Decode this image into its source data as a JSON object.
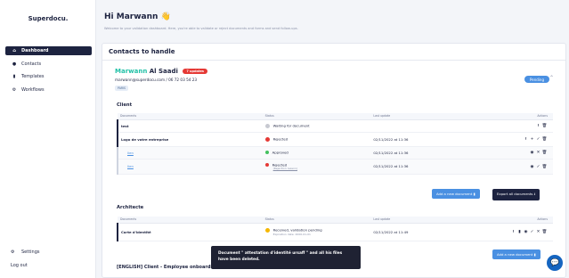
{
  "sidebar": {
    "brand": "Superdocu.",
    "items": [
      {
        "label": "Dashboard",
        "icon": "home-icon",
        "glyph": "⌂"
      },
      {
        "label": "Contacts",
        "icon": "user-icon",
        "glyph": "●"
      },
      {
        "label": "Templates",
        "icon": "file-icon",
        "glyph": "▮"
      },
      {
        "label": "Workflows",
        "icon": "workflow-icon",
        "glyph": "⚙"
      }
    ],
    "settings": "Settings",
    "logout": "Log out"
  },
  "header": {
    "greeting": "Hi Marwann 👋",
    "subtitle": "Welcome to your validation dashboard. Here, you're able to validate or reject documents and forms and send follow-ups."
  },
  "main": {
    "title": "Contacts to handle",
    "contact": {
      "first_name": "Marwann",
      "last_name": "Al Saadi",
      "updates_badge": "7 updates",
      "details": "marwann@superdocu.com / 06 72 03 54 23",
      "tag": "PARIS",
      "status": "Pending"
    },
    "client": {
      "title": "Client",
      "columns": [
        "Documents",
        "Status",
        "Last update",
        "Actions"
      ],
      "rows": [
        {
          "doc": "test",
          "status": "Waiting for document",
          "date": "",
          "color": "#c7c9d1"
        },
        {
          "doc": "Logo de votre entreprise",
          "status": "Rejected",
          "date": "02/11/2022 at 11:36",
          "color": "#e53935"
        },
        {
          "doc": "lien",
          "status": "Approved",
          "date": "02/11/2022 at 11:36",
          "color": "#43c15e"
        },
        {
          "doc": "lien",
          "status": "Rejected",
          "status_sub": "(Rejection reason)",
          "date": "02/11/2022 at 11:36",
          "color": "#e53935"
        }
      ],
      "add_button": "Add a new document",
      "export_button": "Export all documents"
    },
    "architecte": {
      "title": "Architecte",
      "columns": [
        "Documents",
        "Status",
        "Last update",
        "Actions"
      ],
      "rows": [
        {
          "doc": "Carte d'identité",
          "status": "Received, validation pending",
          "status_sub": "Expiration date: 2000-01-01",
          "date": "02/11/2022 at 11:49",
          "color": "#f5b700"
        }
      ],
      "add_button": "Add a new document"
    },
    "next_section": "[ENGLISH] Client - Employee onboarding"
  },
  "toast": "Document \" attestation d'identité ursaff \" and all his files have been deleted.",
  "colors": {
    "navy": "#1d2340",
    "blue": "#4a90e2",
    "teal": "#22c1a7",
    "red": "#e53935"
  }
}
